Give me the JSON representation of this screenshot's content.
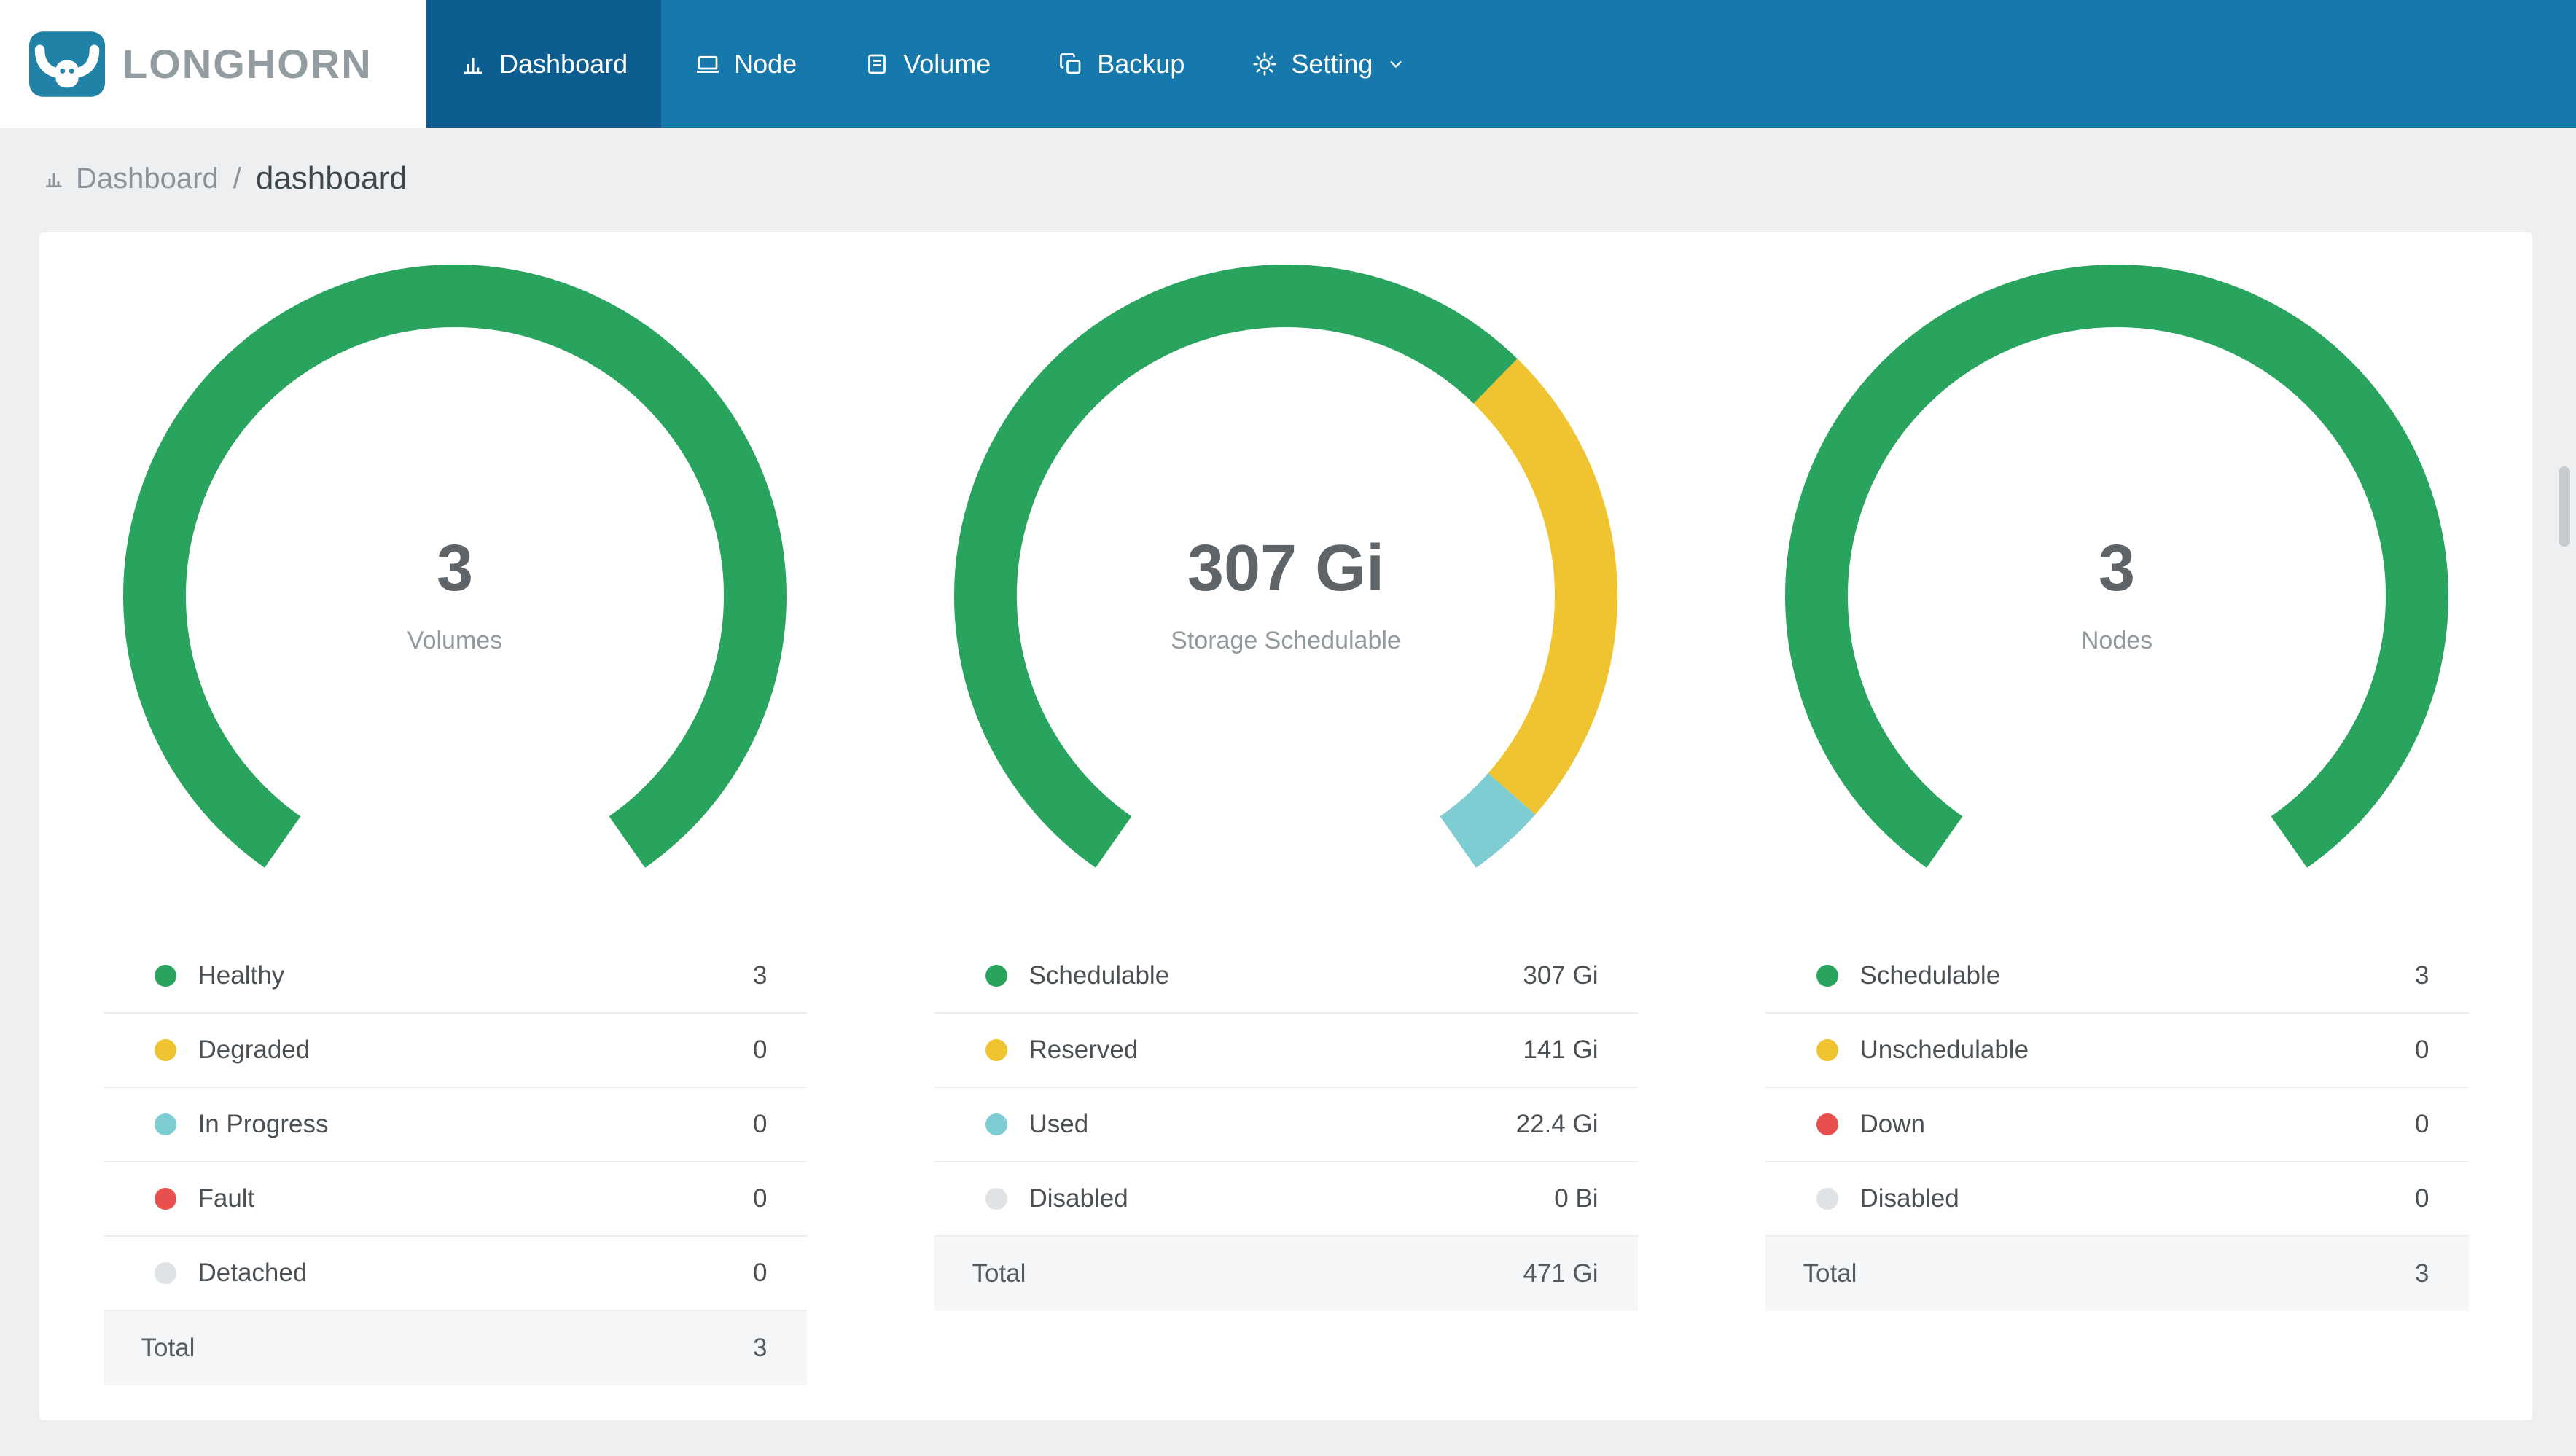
{
  "app_title": "LONGHORN",
  "nav": {
    "items": [
      {
        "label": "Dashboard",
        "icon": "dashboard-icon",
        "active": true
      },
      {
        "label": "Node",
        "icon": "node-icon",
        "active": false
      },
      {
        "label": "Volume",
        "icon": "volume-icon",
        "active": false
      },
      {
        "label": "Backup",
        "icon": "backup-icon",
        "active": false
      },
      {
        "label": "Setting",
        "icon": "setting-icon",
        "active": false,
        "dropdown": true
      }
    ]
  },
  "breadcrumb": {
    "root": "Dashboard",
    "separator": "/",
    "current": "dashboard"
  },
  "colors": {
    "navbar": "#1778AC",
    "navbar_active": "#0D5D91",
    "logo_teal": "#1F82A6",
    "green": "#28A45E",
    "yellow": "#F0C330",
    "teal": "#7DCDD3",
    "red": "#E7504F",
    "gray": "#DFE3E5"
  },
  "chart_data": [
    {
      "type": "gauge",
      "center_value": "3",
      "center_label": "Volumes",
      "arc": {
        "start_deg": 215,
        "sweep_deg": 290
      },
      "segments": [
        {
          "label": "Healthy",
          "value": 3,
          "display": "3",
          "color": "#28A45E"
        },
        {
          "label": "Degraded",
          "value": 0,
          "display": "0",
          "color": "#F0C330"
        },
        {
          "label": "In Progress",
          "value": 0,
          "display": "0",
          "color": "#7DCDD3"
        },
        {
          "label": "Fault",
          "value": 0,
          "display": "0",
          "color": "#E7504F"
        },
        {
          "label": "Detached",
          "value": 0,
          "display": "0",
          "color": "#DFE3E5"
        }
      ],
      "total": {
        "label": "Total",
        "display": "3"
      }
    },
    {
      "type": "gauge",
      "center_value": "307 Gi",
      "center_label": "Storage Schedulable",
      "arc": {
        "start_deg": 215,
        "sweep_deg": 290
      },
      "segments": [
        {
          "label": "Schedulable",
          "value": 307,
          "display": "307 Gi",
          "color": "#28A45E"
        },
        {
          "label": "Reserved",
          "value": 141,
          "display": "141 Gi",
          "color": "#F0C330"
        },
        {
          "label": "Used",
          "value": 22.4,
          "display": "22.4 Gi",
          "color": "#7DCDD3"
        },
        {
          "label": "Disabled",
          "value": 0,
          "display": "0 Bi",
          "color": "#DFE3E5"
        }
      ],
      "total": {
        "label": "Total",
        "display": "471 Gi"
      }
    },
    {
      "type": "gauge",
      "center_value": "3",
      "center_label": "Nodes",
      "arc": {
        "start_deg": 215,
        "sweep_deg": 290
      },
      "segments": [
        {
          "label": "Schedulable",
          "value": 3,
          "display": "3",
          "color": "#28A45E"
        },
        {
          "label": "Unschedulable",
          "value": 0,
          "display": "0",
          "color": "#F0C330"
        },
        {
          "label": "Down",
          "value": 0,
          "display": "0",
          "color": "#E7504F"
        },
        {
          "label": "Disabled",
          "value": 0,
          "display": "0",
          "color": "#DFE3E5"
        }
      ],
      "total": {
        "label": "Total",
        "display": "3"
      }
    }
  ]
}
